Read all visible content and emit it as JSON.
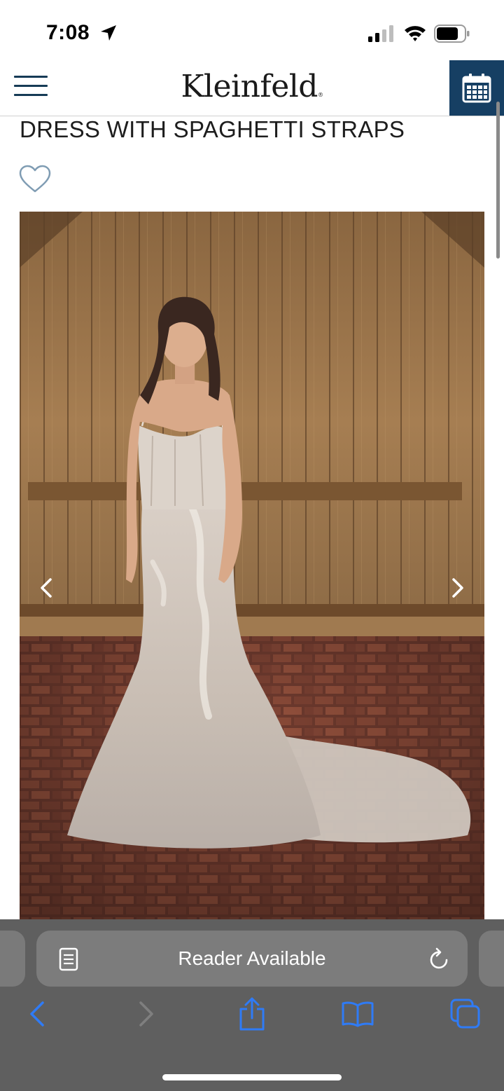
{
  "status_bar": {
    "time": "7:08"
  },
  "header": {
    "logo": "Kleinfeld",
    "logo_mark": "®"
  },
  "product": {
    "title": "DRESS WITH SPAGHETTI STRAPS"
  },
  "safari": {
    "address_text": "Reader Available"
  },
  "colors": {
    "brand_navy": "#163f63",
    "icon_blue": "#1a4a6e",
    "toolbar_bg": "#5f5f5f",
    "toolbar_icon": "#2f7bf6"
  },
  "icons": [
    "location-arrow-icon",
    "signal-icon",
    "wifi-icon",
    "battery-icon",
    "menu-icon",
    "calendar-icon",
    "heart-icon",
    "chevron-left-icon",
    "chevron-right-icon",
    "reader-icon",
    "reload-icon",
    "back-icon",
    "forward-icon",
    "share-icon",
    "bookmarks-icon",
    "tabs-icon"
  ]
}
